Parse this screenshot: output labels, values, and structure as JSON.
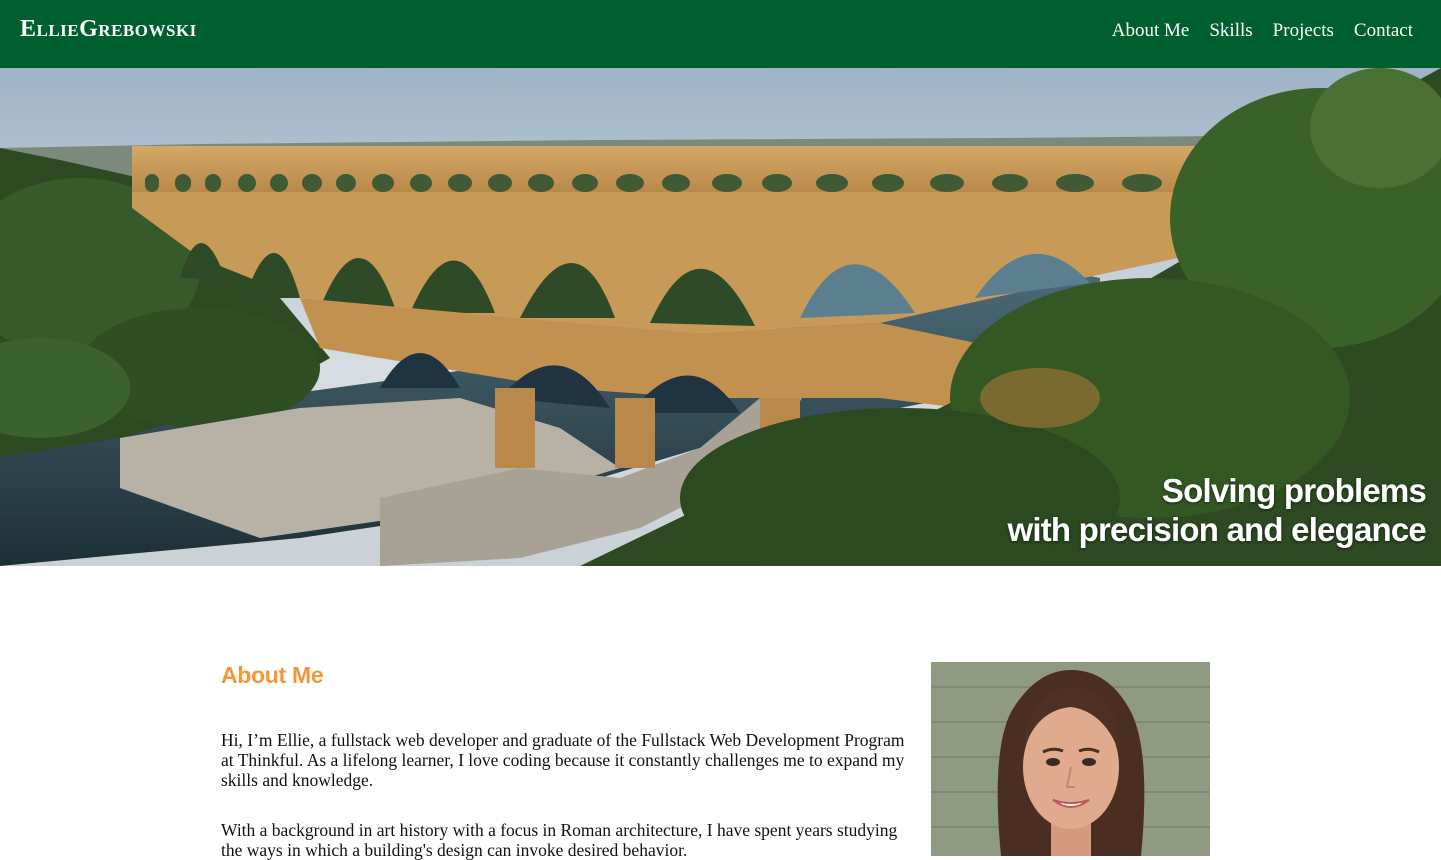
{
  "header": {
    "brand": "EllieGrebowski",
    "nav": [
      "About Me",
      "Skills",
      "Projects",
      "Contact"
    ]
  },
  "hero": {
    "tagline_line1": "Solving problems",
    "tagline_line2": "with precision and elegance",
    "image": "pont-du-gard-aqueduct-photo"
  },
  "about": {
    "heading": "About Me",
    "paragraph1": "Hi, I’m Ellie, a fullstack web developer and graduate of the Fullstack Web Development Program at Thinkful. As a lifelong learner, I love coding because it constantly challenges me to expand my skills and knowledge.",
    "paragraph2": "With a background in art history with a focus in Roman architecture, I have spent years studying the ways in which a building's design can invoke desired behavior.",
    "photo": "ellie-portrait-photo"
  },
  "colors": {
    "header_bg": "#005f2f",
    "accent": "#f4963a",
    "text": "#111111"
  }
}
